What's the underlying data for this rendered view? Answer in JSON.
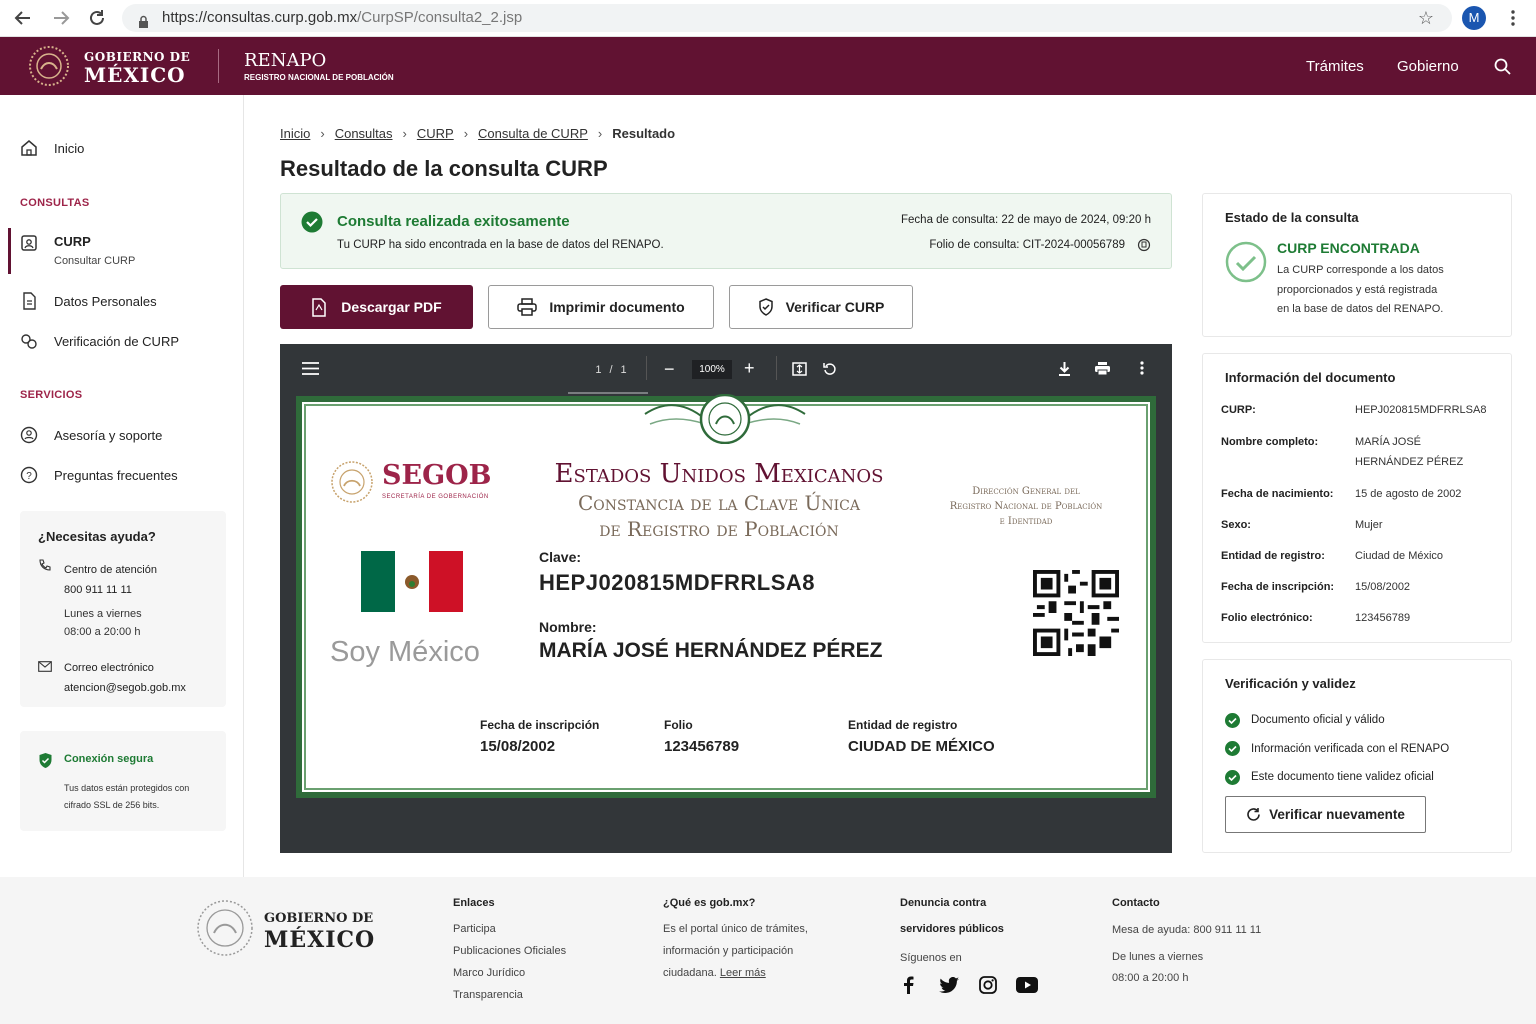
{
  "browser": {
    "url_host": "https://consultas.curp.gob.mx",
    "url_path": "/CurpSP/consulta2_2.jsp",
    "avatar": "M"
  },
  "header": {
    "gob_line1": "GOBIERNO DE",
    "gob_line2": "MÉXICO",
    "renapo": "RENAPO",
    "renapo_sub": "REGISTRO NACIONAL DE POBLACIÓN",
    "nav": [
      "Trámites",
      "Gobierno"
    ]
  },
  "sidebar": {
    "inicio": "Inicio",
    "consultas_heading": "CONSULTAS",
    "curp": "CURP",
    "curp_sub": "Consultar CURP",
    "datos": "Datos Personales",
    "verificacion": "Verificación de CURP",
    "servicios_heading": "SERVICIOS",
    "asesoria": "Asesoría y soporte",
    "preguntas": "Preguntas frecuentes",
    "help": {
      "title": "¿Necesitas ayuda?",
      "center_label": "Centro de atención",
      "center_phone": "800 911 11 11",
      "days": "Lunes a viernes",
      "hours": "08:00 a 20:00 h",
      "email_label": "Correo electrónico",
      "email": "atencion@segob.gob.mx"
    },
    "secure": {
      "title": "Conexión segura",
      "line1": "Tus datos están protegidos con",
      "line2": "cifrado SSL de 256 bits."
    }
  },
  "breadcrumb": [
    "Inicio",
    "Consultas",
    "CURP",
    "Consulta de CURP",
    "Resultado"
  ],
  "page_title": "Resultado de la consulta CURP",
  "success": {
    "title": "Consulta realizada exitosamente",
    "text": "Tu CURP ha sido encontrada en la base de datos del RENAPO.",
    "date": "Fecha de consulta: 22 de mayo de 2024, 09:20 h",
    "folio_label": "Folio de consulta:",
    "folio": "CIT-2024-00056789"
  },
  "buttons": {
    "download": "Descargar PDF",
    "print": "Imprimir documento",
    "verify": "Verificar CURP"
  },
  "viewer": {
    "page": "1",
    "sep": "/",
    "total": "1",
    "zoom": "100%"
  },
  "document": {
    "segob": "SEGOB",
    "segob_sub": "SECRETARÍA DE GOBERNACIÓN",
    "soy_mexico": "Soy México",
    "title1": "Estados Unidos Mexicanos",
    "title2": "Constancia de la Clave Única",
    "title3": "de Registro de Población",
    "dg1": "Dirección General del",
    "dg2": "Registro Nacional de Población",
    "dg3": "e Identidad",
    "clave_label": "Clave:",
    "clave": "HEPJ020815MDFRRLSA8",
    "nombre_label": "Nombre:",
    "nombre": "MARÍA JOSÉ HERNÁNDEZ PÉREZ",
    "fecha_label": "Fecha de inscripción",
    "fecha": "15/08/2002",
    "folio_label": "Folio",
    "folio": "123456789",
    "entidad_label": "Entidad de registro",
    "entidad": "CIUDAD DE MÉXICO"
  },
  "estado": {
    "title": "Estado de la consulta",
    "status": "CURP ENCONTRADA",
    "l1": "La CURP corresponde a los datos",
    "l2": "proporcionados y está registrada",
    "l3": "en la base de datos del RENAPO."
  },
  "info": {
    "title": "Información del documento",
    "rows": [
      {
        "k": "CURP:",
        "v": "HEPJ020815MDFRRLSA8"
      },
      {
        "k": "Nombre completo:",
        "v": "MARÍA JOSÉ",
        "v2": "HERNÁNDEZ PÉREZ"
      },
      {
        "k": "Fecha de nacimiento:",
        "v": "15 de agosto de 2002"
      },
      {
        "k": "Sexo:",
        "v": "Mujer"
      },
      {
        "k": "Entidad de registro:",
        "v": "Ciudad de México"
      },
      {
        "k": "Fecha de inscripción:",
        "v": "15/08/2002"
      },
      {
        "k": "Folio electrónico:",
        "v": "123456789"
      }
    ]
  },
  "validez": {
    "title": "Verificación y validez",
    "items": [
      "Documento oficial y válido",
      "Información verificada con el RENAPO",
      "Este documento tiene validez oficial"
    ],
    "button": "Verificar nuevamente"
  },
  "footer": {
    "gob1": "GOBIERNO DE",
    "gob2": "MÉXICO",
    "enlaces_title": "Enlaces",
    "enlaces": [
      "Participa",
      "Publicaciones Oficiales",
      "Marco Jurídico",
      "Transparencia"
    ],
    "que_title": "¿Qué es gob.mx?",
    "que_l1": "Es el portal único de trámites,",
    "que_l2": "información y participación",
    "que_l3": "ciudadana.",
    "leer": "Leer más",
    "denuncia1": "Denuncia contra",
    "denuncia2": "servidores públicos",
    "siguenos": "Síguenos en",
    "contacto_title": "Contacto",
    "mesa": "Mesa de ayuda: 800 911 11 11",
    "dias": "De lunes a viernes",
    "horas": "08:00 a 20:00 h"
  },
  "colors": {
    "brand": "#611232",
    "accent": "#9d2449",
    "success": "#1e7b34"
  }
}
